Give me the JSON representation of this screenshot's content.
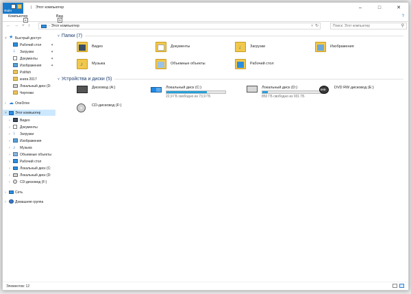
{
  "window": {
    "title": "Этот компьютер"
  },
  "titlebar": {
    "file_tab": "Файл",
    "separator": "|"
  },
  "ribbon": {
    "tabs": [
      "Компьютер",
      "Вид"
    ],
    "key_hints": [
      "К",
      "В"
    ],
    "help": "?"
  },
  "address": {
    "path": "Этот компьютер"
  },
  "search": {
    "placeholder": "Поиск: Этот компьютер"
  },
  "nav": {
    "quick_access": "Быстрый доступ",
    "quick_items": [
      {
        "label": "Рабочий стол",
        "icon": "desktop-icon",
        "pinned": true
      },
      {
        "label": "Загрузки",
        "icon": "downloads-icon",
        "pinned": true
      },
      {
        "label": "Документы",
        "icon": "documents-icon",
        "pinned": true
      },
      {
        "label": "Изображения",
        "icon": "pictures-icon",
        "pinned": true
      },
      {
        "label": "Polifish",
        "icon": "folder-icon",
        "pinned": false
      },
      {
        "label": "книга 2017",
        "icon": "folder-icon",
        "pinned": false
      },
      {
        "label": "Локальный диск (D:",
        "icon": "disk-icon",
        "pinned": false
      },
      {
        "label": "Чертежи",
        "icon": "folder-icon",
        "pinned": false
      }
    ],
    "onedrive": "OneDrive",
    "this_pc": "Этот компьютер",
    "pc_items": [
      {
        "label": "Видео",
        "icon": "videos-icon"
      },
      {
        "label": "Документы",
        "icon": "documents-icon"
      },
      {
        "label": "Загрузки",
        "icon": "downloads-icon"
      },
      {
        "label": "Изображения",
        "icon": "pictures-icon"
      },
      {
        "label": "Музыка",
        "icon": "music-icon"
      },
      {
        "label": "Объемные объекты",
        "icon": "3d-objects-icon"
      },
      {
        "label": "Рабочий стол",
        "icon": "desktop-icon"
      },
      {
        "label": "Локальный диск (C:",
        "icon": "windows-drive-icon"
      },
      {
        "label": "Локальный диск (D:",
        "icon": "disk-icon"
      },
      {
        "label": "CD-дисковод (F:)",
        "icon": "cd-drive-icon"
      }
    ],
    "network": "Сеть",
    "homegroup": "Домашняя группа"
  },
  "main": {
    "folders_title": "Папки (7)",
    "folders": [
      {
        "label": "Видео",
        "icon": "videos-folder-icon"
      },
      {
        "label": "Документы",
        "icon": "documents-folder-icon"
      },
      {
        "label": "Загрузки",
        "icon": "downloads-folder-icon"
      },
      {
        "label": "Изображения",
        "icon": "pictures-folder-icon"
      },
      {
        "label": "Музыка",
        "icon": "music-folder-icon"
      },
      {
        "label": "Объемные объекты",
        "icon": "3d-objects-folder-icon"
      },
      {
        "label": "Рабочий стол",
        "icon": "desktop-folder-icon"
      }
    ],
    "devices_title": "Устройства и диски (5)",
    "devices": [
      {
        "label": "Дисковод (A:)",
        "icon": "floppy-drive-icon",
        "free_text": ""
      },
      {
        "label": "Локальный диск (C:)",
        "icon": "windows-drive-icon",
        "free_text": "22,9 ГБ свободно из 73,9 ГБ",
        "used_fraction": 0.69
      },
      {
        "label": "Локальный диск (D:)",
        "icon": "hard-drive-icon",
        "free_text": "850 ГБ свободно из 931 ГБ",
        "used_fraction": 0.09
      },
      {
        "label": "DVD RW дисковод (E:)",
        "icon": "dvd-drive-icon",
        "free_text": "",
        "badge": "DVD"
      },
      {
        "label": "CD-дисковод (F:)",
        "icon": "cd-drive-icon",
        "free_text": ""
      }
    ]
  },
  "status": {
    "count": "Элементов: 12"
  },
  "colors": {
    "accent": "#1979ca",
    "selection": "#cce8ff",
    "drive_fill": "#26a0da",
    "folder": "#f2c84b"
  }
}
